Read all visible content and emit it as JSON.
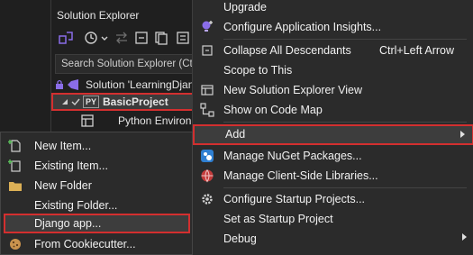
{
  "solution_explorer": {
    "title": "Solution Explorer",
    "search_placeholder": "Search Solution Explorer (Ct",
    "tree": {
      "solution": "Solution 'LearningDjan",
      "project": "BasicProject",
      "project_badge": "PY",
      "python_env": "Python Environm"
    }
  },
  "context_menu": {
    "items": {
      "upgrade": "Upgrade",
      "app_insights": "Configure Application Insights...",
      "collapse": "Collapse All Descendants",
      "collapse_shortcut": "Ctrl+Left Arrow",
      "scope": "Scope to This",
      "new_view": "New Solution Explorer View",
      "code_map": "Show on Code Map",
      "add": "Add",
      "nuget": "Manage NuGet Packages...",
      "client_libs": "Manage Client-Side Libraries...",
      "startup_projects": "Configure Startup Projects...",
      "set_startup": "Set as Startup Project",
      "debug": "Debug"
    }
  },
  "add_submenu": {
    "items": {
      "new_item": "New Item...",
      "existing_item": "Existing Item...",
      "new_folder": "New Folder",
      "existing_folder": "Existing Folder...",
      "django_app": "Django app...",
      "cookiecutter": "From Cookiecutter..."
    }
  },
  "colors": {
    "highlight_border": "#d32f2f",
    "menu_background": "#2b2b2b",
    "accent_purple": "#8a6de9"
  }
}
